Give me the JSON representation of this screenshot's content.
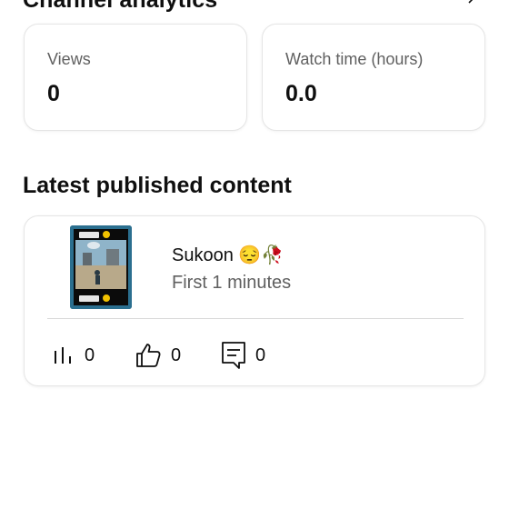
{
  "header": {
    "title": "Channel analytics"
  },
  "stats": {
    "views": {
      "label": "Views",
      "value": "0"
    },
    "watch_time": {
      "label": "Watch time (hours)",
      "value": "0.0"
    }
  },
  "latest": {
    "title": "Latest published content",
    "item": {
      "title": "Sukoon 😔🥀",
      "subtitle": "First 1 minutes",
      "thumbnail_text_top": "Sukoon 😔",
      "thumbnail_text_bottom": "Sukoon 😔",
      "metrics": {
        "views": "0",
        "likes": "0",
        "comments": "0"
      }
    }
  },
  "icons": {
    "views": "bar-chart-icon",
    "likes": "thumbs-up-icon",
    "comments": "comment-icon",
    "header_more": "chevron-right-icon"
  }
}
